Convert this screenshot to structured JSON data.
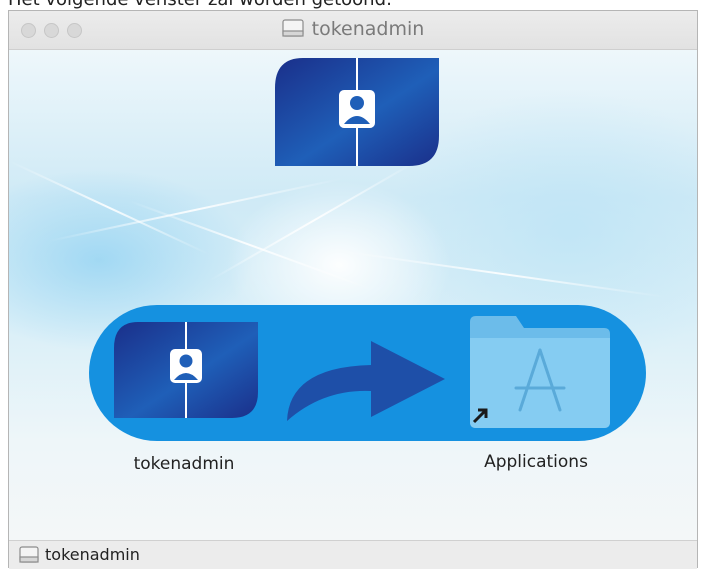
{
  "caption": "Het volgende venster zal worden getoond:",
  "window": {
    "title": "tokenadmin"
  },
  "installer": {
    "app_label": "tokenadmin",
    "applications_label": "Applications"
  },
  "statusbar": {
    "text": "tokenadmin"
  },
  "colors": {
    "pill": "#1591e0",
    "app_icon_dark": "#1a2f8a",
    "arrow": "#1e4fa8",
    "folder": "#7cc6ef"
  },
  "icons": [
    "close-icon",
    "minimize-icon",
    "zoom-icon",
    "drive-icon",
    "app-icon",
    "arrow-icon",
    "applications-folder-icon",
    "alias-arrow-icon"
  ]
}
